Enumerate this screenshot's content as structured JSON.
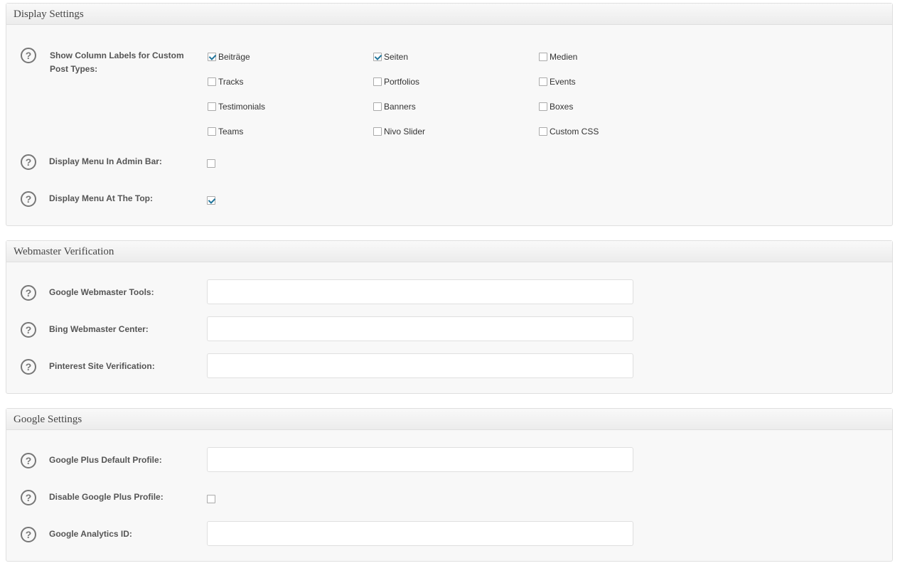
{
  "display_settings": {
    "title": "Display Settings",
    "column_labels": {
      "label_line1": "Show Column Labels for Custom",
      "label_line2": "Post Types:",
      "options": [
        {
          "label": "Beiträge",
          "checked": true
        },
        {
          "label": "Seiten",
          "checked": true
        },
        {
          "label": "Medien",
          "checked": false
        },
        {
          "label": "Tracks",
          "checked": false
        },
        {
          "label": "Portfolios",
          "checked": false
        },
        {
          "label": "Events",
          "checked": false
        },
        {
          "label": "Testimonials",
          "checked": false
        },
        {
          "label": "Banners",
          "checked": false
        },
        {
          "label": "Boxes",
          "checked": false
        },
        {
          "label": "Teams",
          "checked": false
        },
        {
          "label": "Nivo Slider",
          "checked": false
        },
        {
          "label": "Custom CSS",
          "checked": false
        }
      ]
    },
    "admin_bar": {
      "label": "Display Menu In Admin Bar:",
      "checked": false
    },
    "menu_top": {
      "label": "Display Menu At The Top:",
      "checked": true
    }
  },
  "webmaster": {
    "title": "Webmaster Verification",
    "google": {
      "label": "Google Webmaster Tools:",
      "value": ""
    },
    "bing": {
      "label": "Bing Webmaster Center:",
      "value": ""
    },
    "pinterest": {
      "label": "Pinterest Site Verification:",
      "value": ""
    }
  },
  "google_settings": {
    "title": "Google Settings",
    "plus_profile": {
      "label": "Google Plus Default Profile:",
      "value": ""
    },
    "disable_plus": {
      "label": "Disable Google Plus Profile:",
      "checked": false
    },
    "analytics": {
      "label": "Google Analytics ID:",
      "value": ""
    }
  },
  "help_icon_glyph": "?",
  "colors": {
    "accent": "#21759b",
    "border": "#dfdfdf",
    "panel_bg": "#f8f8f8"
  }
}
